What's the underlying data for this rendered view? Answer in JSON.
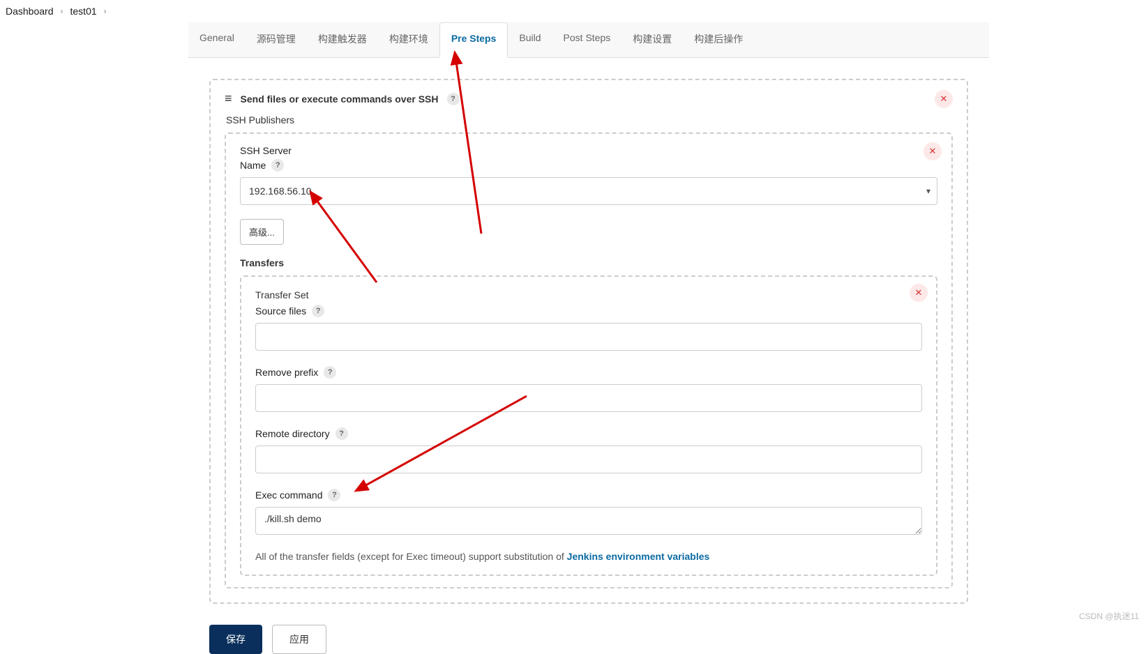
{
  "breadcrumb": {
    "home": "Dashboard",
    "job": "test01"
  },
  "tabs": [
    {
      "label": "General"
    },
    {
      "label": "源码管理"
    },
    {
      "label": "构建触发器"
    },
    {
      "label": "构建环境"
    },
    {
      "label": "Pre Steps",
      "active": true
    },
    {
      "label": "Build"
    },
    {
      "label": "Post Steps"
    },
    {
      "label": "构建设置"
    },
    {
      "label": "构建后操作"
    }
  ],
  "section": {
    "title": "Send files or execute commands over SSH",
    "publishers_label": "SSH Publishers",
    "server_group_label": "SSH Server",
    "server_name_label": "Name",
    "server_name_value": "192.168.56.10",
    "advanced_button": "高级...",
    "transfers_label": "Transfers",
    "transfer_set": {
      "title": "Transfer Set",
      "source_files_label": "Source files",
      "source_files_value": "",
      "remove_prefix_label": "Remove prefix",
      "remove_prefix_value": "",
      "remote_directory_label": "Remote directory",
      "remote_directory_value": "",
      "exec_command_label": "Exec command",
      "exec_command_value": "./kill.sh demo"
    },
    "footnote_text": "All of the transfer fields (except for Exec timeout) support substitution of ",
    "footnote_link": "Jenkins environment variables"
  },
  "buttons": {
    "save": "保存",
    "apply": "应用"
  },
  "icons": {
    "close": "✕",
    "help": "?",
    "caret": "▾",
    "drag": "≡",
    "sep": "›"
  },
  "watermark": "CSDN @执迷11"
}
